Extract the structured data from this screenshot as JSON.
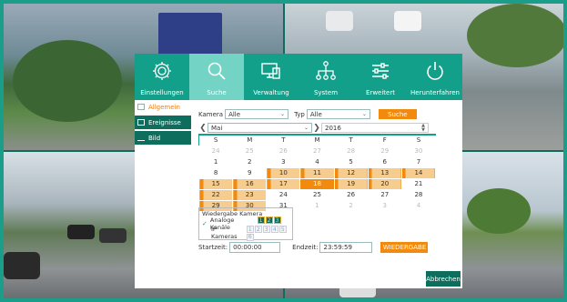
{
  "nav": {
    "items": [
      {
        "label": "Einstellungen",
        "icon": "gear-icon",
        "active": false
      },
      {
        "label": "Suche",
        "icon": "search-icon",
        "active": true
      },
      {
        "label": "Verwaltung",
        "icon": "monitor-icon",
        "active": false
      },
      {
        "label": "System",
        "icon": "network-icon",
        "active": false
      },
      {
        "label": "Erweitert",
        "icon": "sliders-icon",
        "active": false
      },
      {
        "label": "Herunterfahren",
        "icon": "power-icon",
        "active": false
      }
    ]
  },
  "sidebar": {
    "items": [
      {
        "label": "Allgemein",
        "active": true
      },
      {
        "label": "Ereignisse",
        "active": false
      },
      {
        "label": "Bild",
        "active": false
      }
    ]
  },
  "search": {
    "camera_label": "Kamera",
    "camera_value": "Alle",
    "type_label": "Typ",
    "type_value": "Alle",
    "search_button": "Suche"
  },
  "calendar": {
    "month": "Mai",
    "year": "2016",
    "weekdays": [
      "S",
      "M",
      "T",
      "M",
      "T",
      "F",
      "S"
    ],
    "weeks": [
      [
        {
          "d": "24",
          "m": true
        },
        {
          "d": "25",
          "m": true
        },
        {
          "d": "26",
          "m": true
        },
        {
          "d": "27",
          "m": true
        },
        {
          "d": "28",
          "m": true
        },
        {
          "d": "29",
          "m": true
        },
        {
          "d": "30",
          "m": true
        }
      ],
      [
        {
          "d": "1"
        },
        {
          "d": "2"
        },
        {
          "d": "3"
        },
        {
          "d": "4"
        },
        {
          "d": "5"
        },
        {
          "d": "6"
        },
        {
          "d": "7"
        }
      ],
      [
        {
          "d": "8"
        },
        {
          "d": "9"
        },
        {
          "d": "10",
          "r": true
        },
        {
          "d": "11",
          "r": true
        },
        {
          "d": "12",
          "r": true
        },
        {
          "d": "13",
          "r": true
        },
        {
          "d": "14",
          "r": true
        }
      ],
      [
        {
          "d": "15",
          "r": true
        },
        {
          "d": "16",
          "r": true
        },
        {
          "d": "17",
          "r": true
        },
        {
          "d": "18",
          "s": true
        },
        {
          "d": "19",
          "r": true
        },
        {
          "d": "20",
          "r": true
        },
        {
          "d": "21"
        }
      ],
      [
        {
          "d": "22",
          "r": true
        },
        {
          "d": "23",
          "r": true
        },
        {
          "d": "24"
        },
        {
          "d": "25"
        },
        {
          "d": "26"
        },
        {
          "d": "27"
        },
        {
          "d": "28"
        }
      ],
      [
        {
          "d": "29",
          "r": true
        },
        {
          "d": "30",
          "r": true
        },
        {
          "d": "31"
        },
        {
          "d": "1",
          "m": true
        },
        {
          "d": "2",
          "m": true
        },
        {
          "d": "3",
          "m": true
        },
        {
          "d": "4",
          "m": true
        }
      ]
    ]
  },
  "playback": {
    "title": "Wiedergabe Kamera",
    "analog_label": "Analoge Kanäle",
    "analog_channels": [
      {
        "n": "1",
        "on": true
      },
      {
        "n": "2",
        "on": true
      },
      {
        "n": "3",
        "on": true
      },
      {
        "n": "4",
        "on": false
      }
    ],
    "ip_label": "IP Kameras",
    "ip_channels": [
      "1",
      "2",
      "3",
      "4",
      "5",
      "6"
    ]
  },
  "time": {
    "start_label": "Startzeit:",
    "start_value": "00:00:00",
    "end_label": "Endzeit:",
    "end_value": "23:59:59",
    "play_button": "WIEDERGABE"
  },
  "cancel_button": "Abbrechen",
  "colors": {
    "accent": "#13a08a",
    "accent_active": "#73d4c6",
    "dark_teal": "#0e6e5e",
    "orange": "#f28a0e",
    "record_fill": "#f7cc8f"
  }
}
